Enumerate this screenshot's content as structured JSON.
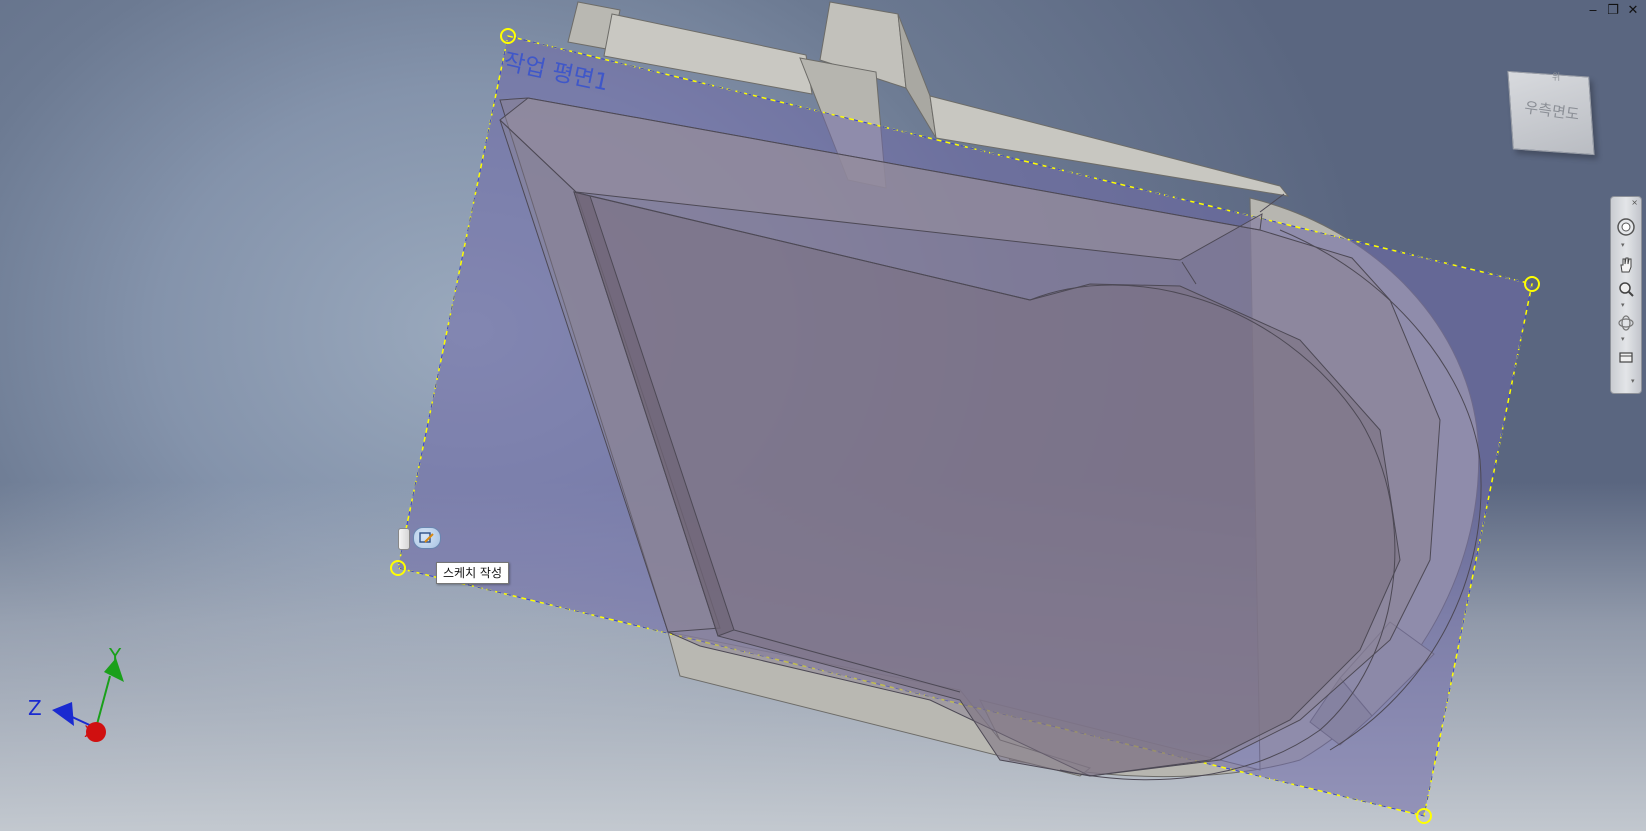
{
  "viewport": {
    "work_plane_label": "작업 평면1",
    "tooltip": "스케치 작성"
  },
  "window_controls": {
    "minimize": "‒",
    "restore": "❐",
    "close": "✕"
  },
  "viewcube": {
    "face_label": "우측면도",
    "top_label": "위"
  },
  "triad": {
    "x_label": "X",
    "y_label": "Y",
    "z_label": "Z",
    "x_color": "#d01010",
    "y_color": "#1aa01a",
    "z_color": "#1a2ad0"
  },
  "navigation_bar": {
    "close": "×",
    "tools": [
      "steeringwheel-icon",
      "pan-icon",
      "zoom-icon",
      "orbit-icon",
      "lookat-icon"
    ]
  },
  "colors": {
    "plane_edge": "#ffff00",
    "plane_fill": "#6f6aa8",
    "solid": "#c4c3bd"
  }
}
